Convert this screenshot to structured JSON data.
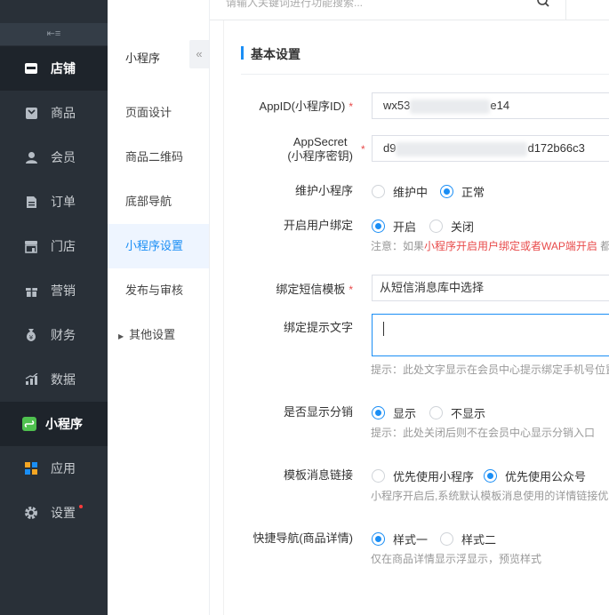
{
  "nav": {
    "items": [
      {
        "label": "店铺",
        "icon": "shop-icon"
      },
      {
        "label": "商品",
        "icon": "goods-icon"
      },
      {
        "label": "会员",
        "icon": "member-icon"
      },
      {
        "label": "订单",
        "icon": "order-icon"
      },
      {
        "label": "门店",
        "icon": "store-icon"
      },
      {
        "label": "营销",
        "icon": "gift-icon"
      },
      {
        "label": "财务",
        "icon": "finance-icon"
      },
      {
        "label": "数据",
        "icon": "chart-icon"
      },
      {
        "label": "小程序",
        "icon": "miniprogram-icon"
      },
      {
        "label": "应用",
        "icon": "apps-icon"
      },
      {
        "label": "设置",
        "icon": "gear-icon"
      }
    ],
    "collapse_glyph": "⇤≡"
  },
  "topbar": {
    "search_placeholder": "请输入关键词进行功能搜索..."
  },
  "subnav": {
    "title": "小程序",
    "collapse_glyph": "«",
    "items": [
      {
        "label": "页面设计"
      },
      {
        "label": "商品二维码"
      },
      {
        "label": "底部导航"
      },
      {
        "label": "小程序设置"
      },
      {
        "label": "发布与审核"
      },
      {
        "label": "其他设置"
      }
    ]
  },
  "main": {
    "section_title": "基本设置",
    "appid": {
      "label": "AppID(小程序ID)",
      "value_prefix": "wx53",
      "value_suffix": "e14"
    },
    "appsecret": {
      "label_line1": "AppSecret",
      "label_line2": "(小程序密钥)",
      "value_prefix": "d9",
      "value_suffix": "d172b66c3"
    },
    "maintain": {
      "label": "维护小程序",
      "options": [
        "维护中",
        "正常"
      ],
      "selected": 1
    },
    "bind": {
      "label": "开启用户绑定",
      "options": [
        "开启",
        "关闭"
      ],
      "selected": 0,
      "hint_prefix": "注意：如果",
      "hint_red": "小程序开启用户绑定或者WAP端开启",
      "hint_suffix": " 都"
    },
    "sms_template": {
      "label": "绑定短信模板",
      "value": "从短信消息库中选择"
    },
    "bind_text": {
      "label": "绑定提示文字",
      "hint": "提示：此处文字显示在会员中心提示绑定手机号位置"
    },
    "show_distribution": {
      "label": "是否显示分销",
      "options": [
        "显示",
        "不显示"
      ],
      "selected": 0,
      "hint": "提示：此处关闭后则不在会员中心显示分销入口"
    },
    "template_link": {
      "label": "模板消息链接",
      "options": [
        "优先使用小程序",
        "优先使用公众号"
      ],
      "selected": 1,
      "hint": "小程序开启后,系统默认模板消息使用的详情链接优先"
    },
    "quick_nav": {
      "label": "快捷导航(商品详情)",
      "options": [
        "样式一",
        "样式二"
      ],
      "selected": 0,
      "hint": "仅在商品详情显示浮显示，预览样式"
    },
    "required_mark": "*"
  },
  "colors": {
    "accent": "#1a8ef5",
    "nav_bg": "#293038",
    "required": "#e84a4a"
  }
}
